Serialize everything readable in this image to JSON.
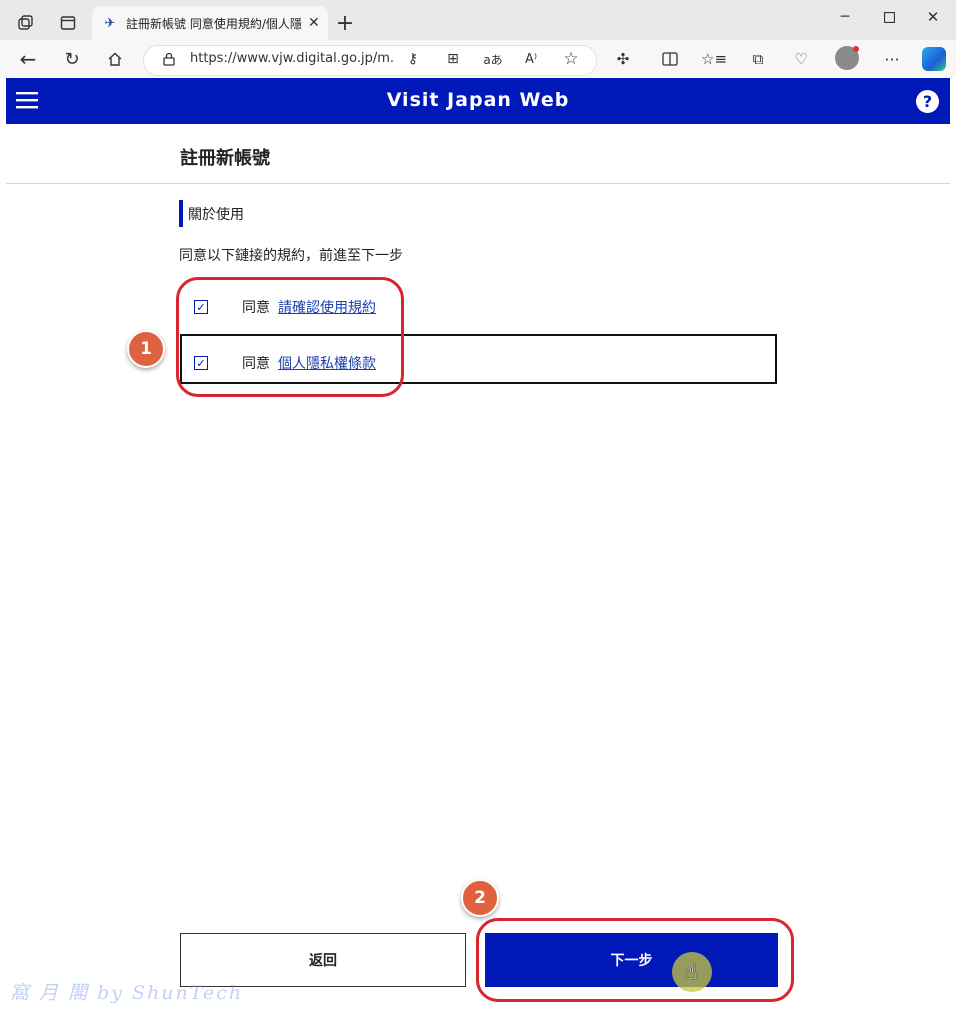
{
  "browser": {
    "tab_title": "註冊新帳號 同意使用規約/個人隱",
    "url": "https://www.vjw.digital.go.jp/m..."
  },
  "app": {
    "brand": "Visit Japan Web"
  },
  "page": {
    "title": "註冊新帳號",
    "section_title": "關於使用",
    "instruction": "同意以下鏈接的規約，前進至下一步",
    "agreements": [
      {
        "prefix": "同意",
        "link": "請確認使用規約",
        "checked": true
      },
      {
        "prefix": "同意",
        "link": "個人隱私權條款",
        "checked": true
      }
    ],
    "back_button": "返回",
    "next_button": "下一步"
  },
  "annotations": {
    "badge1": "1",
    "badge2": "2",
    "ring_color": "#d9252e",
    "badge_color": "#e0613e"
  },
  "watermark": "窩 月 閣  by  ShunTech",
  "colors": {
    "brand_blue": "#0019b8",
    "link_blue": "#1a3fae"
  }
}
